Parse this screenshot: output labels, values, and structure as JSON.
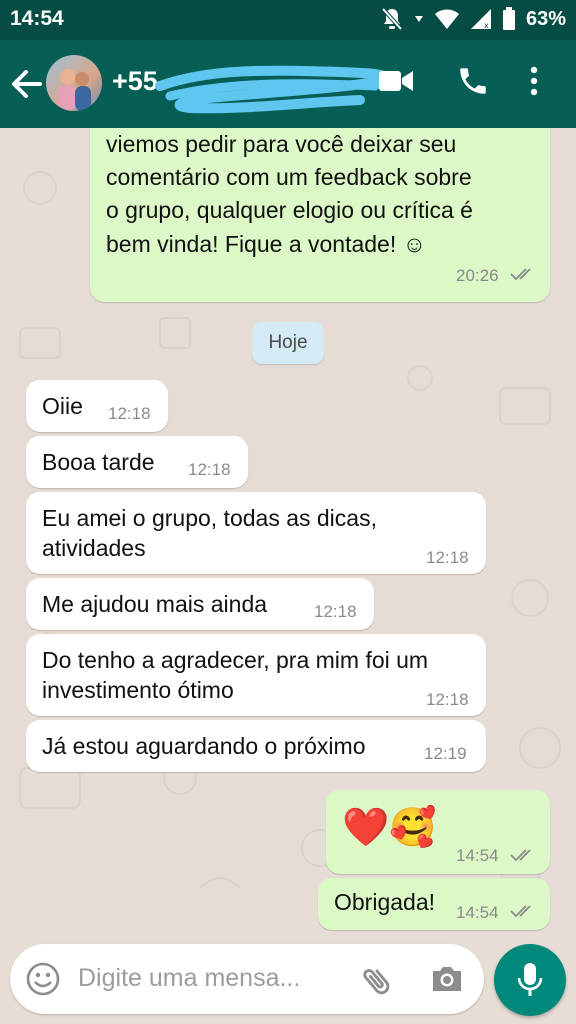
{
  "status_bar": {
    "time": "14:54",
    "battery": "63%"
  },
  "header": {
    "contact_visible": "+55",
    "icons": [
      "back-arrow-icon",
      "video-call-icon",
      "phone-icon",
      "more-vert-icon"
    ]
  },
  "messages": [
    {
      "direction": "out",
      "text_lines": [
        "viemos pedir para você deixar seu",
        "comentário com um feedback sobre",
        "o grupo, qualquer elogio ou crítica é",
        "bem vinda! Fique a vontade! ☺"
      ],
      "time": "20:26"
    },
    {
      "direction": "date",
      "text": "Hoje"
    },
    {
      "direction": "in",
      "text_lines": [
        "Oiie"
      ],
      "time": "12:18"
    },
    {
      "direction": "in",
      "text_lines": [
        "Booa tarde"
      ],
      "time": "12:18"
    },
    {
      "direction": "in",
      "text_lines": [
        "Eu amei o grupo, todas as dicas,",
        "atividades"
      ],
      "time": "12:18"
    },
    {
      "direction": "in",
      "text_lines": [
        "Me ajudou mais ainda"
      ],
      "time": "12:18"
    },
    {
      "direction": "in",
      "text_lines": [
        "Do tenho a agradecer, pra mim foi um",
        "investimento ótimo"
      ],
      "time": "12:18"
    },
    {
      "direction": "in",
      "text_lines": [
        "Já estou aguardando o próximo"
      ],
      "time": "12:19"
    },
    {
      "direction": "out",
      "text_lines": [
        "❤️🥰"
      ],
      "time": "14:54"
    },
    {
      "direction": "out",
      "text_lines": [
        "Obrigada!"
      ],
      "time": "14:54"
    }
  ],
  "composer": {
    "placeholder": "Digite uma mensa..."
  },
  "colors": {
    "header": "#075e54",
    "status_bar": "#054d44",
    "outgoing_bubble": "#dcf8c6",
    "incoming_bubble": "#ffffff",
    "mic_button": "#00897b",
    "read_ticks": "#8a8a8a"
  }
}
